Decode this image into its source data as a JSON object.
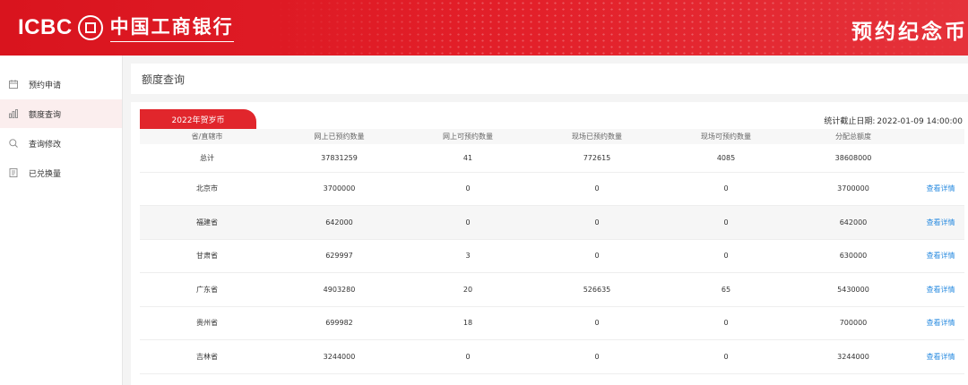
{
  "header": {
    "logo_text": "ICBC",
    "bank_name": "中国工商银行",
    "page_title": "预约纪念币"
  },
  "sidebar": {
    "items": [
      {
        "label": "预约申请",
        "icon": "calendar-icon",
        "active": false
      },
      {
        "label": "额度查询",
        "icon": "chart-icon",
        "active": true
      },
      {
        "label": "查询修改",
        "icon": "search-icon",
        "active": false
      },
      {
        "label": "已兑换量",
        "icon": "document-icon",
        "active": false
      }
    ]
  },
  "main": {
    "title": "额度查询",
    "tab_label": "2022年贺岁币",
    "stat_label": "统计截止日期:",
    "stat_date": "2022-01-09 14:00:00",
    "columns": [
      "省/直辖市",
      "网上已预约数量",
      "网上可预约数量",
      "现场已预约数量",
      "现场可预约数量",
      "分配总额度",
      ""
    ],
    "rows": [
      {
        "region": "总计",
        "online_reserved": "37831259",
        "online_available": "41",
        "onsite_reserved": "772615",
        "onsite_available": "4085",
        "total_quota": "38608000",
        "action": ""
      },
      {
        "region": "北京市",
        "online_reserved": "3700000",
        "online_available": "0",
        "onsite_reserved": "0",
        "onsite_available": "0",
        "total_quota": "3700000",
        "action": "查看详情"
      },
      {
        "region": "福建省",
        "online_reserved": "642000",
        "online_available": "0",
        "onsite_reserved": "0",
        "onsite_available": "0",
        "total_quota": "642000",
        "action": "查看详情"
      },
      {
        "region": "甘肃省",
        "online_reserved": "629997",
        "online_available": "3",
        "onsite_reserved": "0",
        "onsite_available": "0",
        "total_quota": "630000",
        "action": "查看详情"
      },
      {
        "region": "广东省",
        "online_reserved": "4903280",
        "online_available": "20",
        "onsite_reserved": "526635",
        "onsite_available": "65",
        "total_quota": "5430000",
        "action": "查看详情"
      },
      {
        "region": "贵州省",
        "online_reserved": "699982",
        "online_available": "18",
        "onsite_reserved": "0",
        "onsite_available": "0",
        "total_quota": "700000",
        "action": "查看详情"
      },
      {
        "region": "吉林省",
        "online_reserved": "3244000",
        "online_available": "0",
        "onsite_reserved": "0",
        "onsite_available": "0",
        "total_quota": "3244000",
        "action": "查看详情"
      }
    ]
  },
  "colors": {
    "brand_red": "#e1262c",
    "link_blue": "#2b8ce0",
    "active_bg": "#fbeeee"
  }
}
